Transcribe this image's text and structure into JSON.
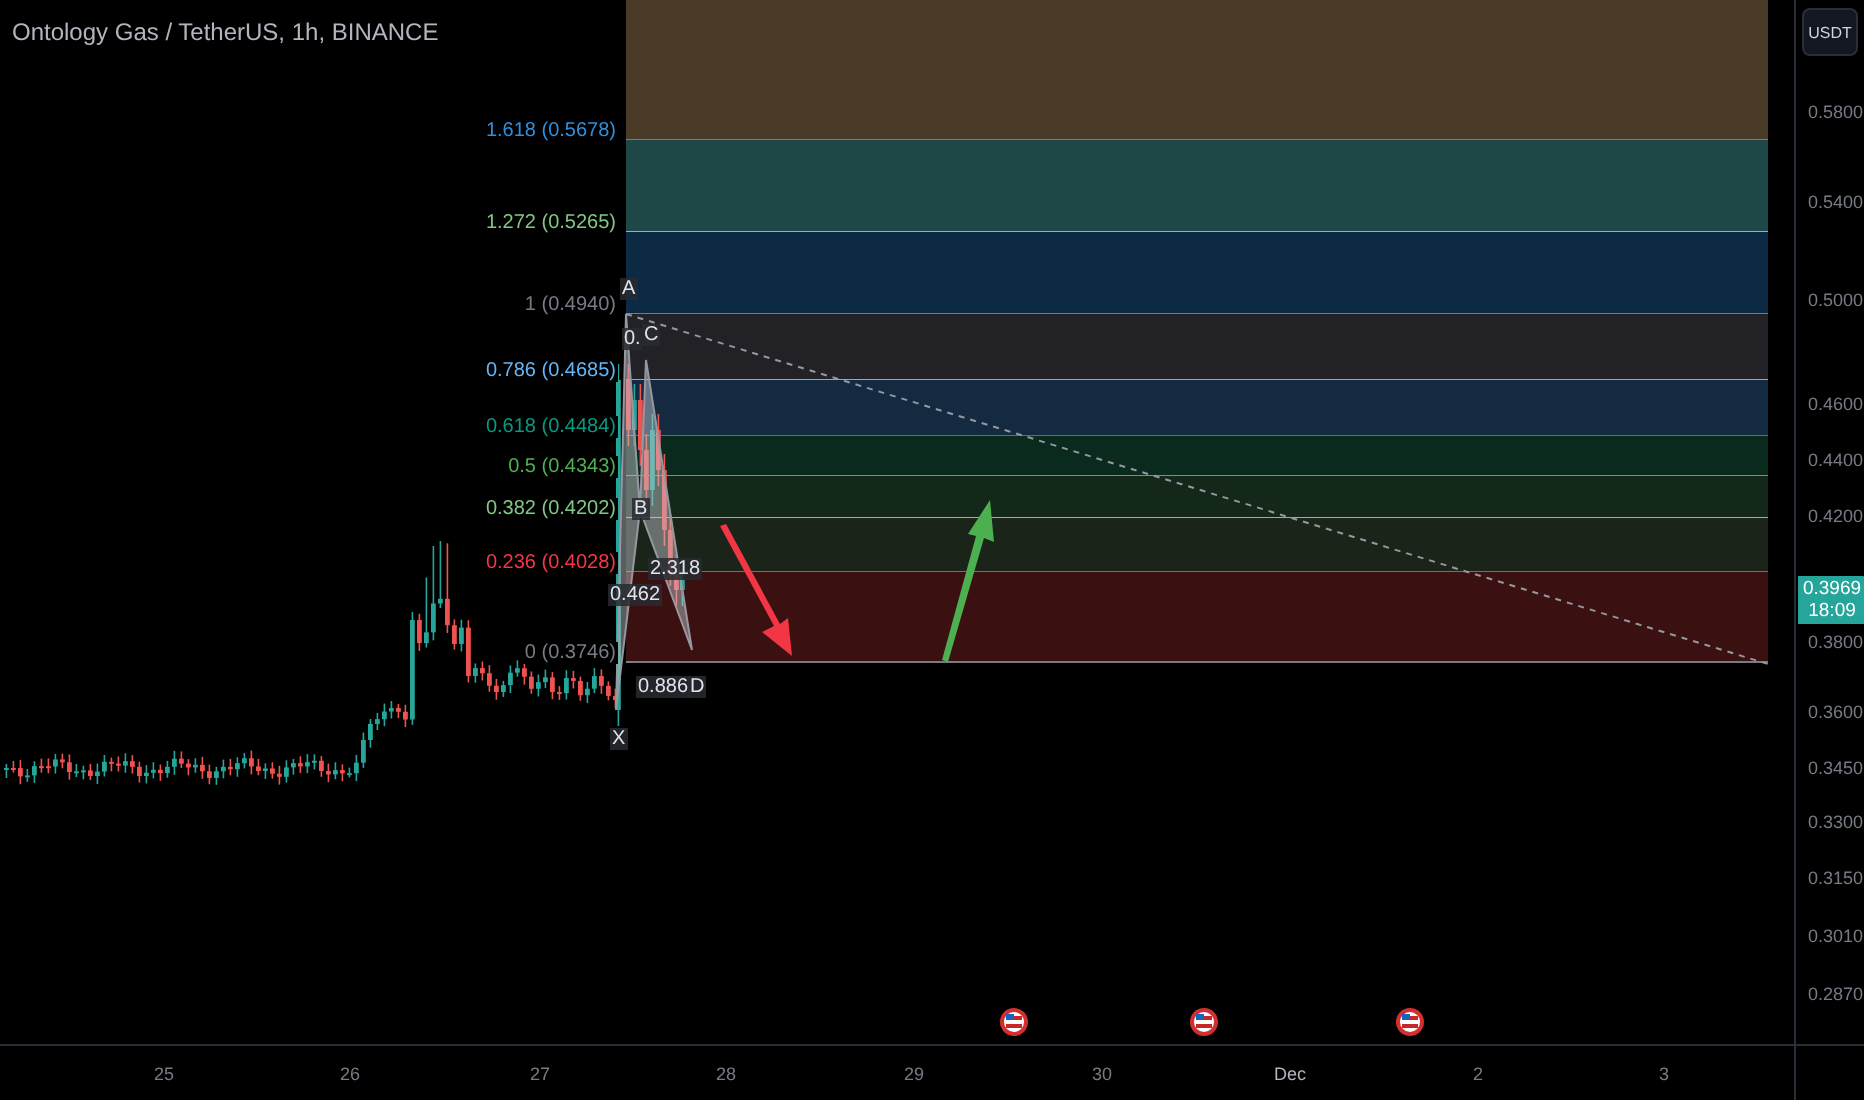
{
  "title": "Ontology Gas / TetherUS, 1h, BINANCE",
  "currency_button": "USDT",
  "fib_levels": [
    {
      "label": "1.618 (0.5678)",
      "color": "#2f8fdd"
    },
    {
      "label": "1.272 (0.5265)",
      "color": "#81c784"
    },
    {
      "label": "1 (0.4940)",
      "color": "#787b86"
    },
    {
      "label": "0.786 (0.4685)",
      "color": "#64b5f6"
    },
    {
      "label": "0.618 (0.4484)",
      "color": "#089981"
    },
    {
      "label": "0.5 (0.4343)",
      "color": "#4caf50"
    },
    {
      "label": "0.382 (0.4202)",
      "color": "#81c784"
    },
    {
      "label": "0.236 (0.4028)",
      "color": "#f23645"
    },
    {
      "label": "0 (0.3746)",
      "color": "#787b86"
    }
  ],
  "pattern_labels": [
    "A",
    "0.",
    "C",
    "B",
    "2.318",
    "0.462",
    "0.886",
    "D",
    "X"
  ],
  "price_axis": [
    "0.5800",
    "0.5400",
    "0.5000",
    "0.4600",
    "0.4400",
    "0.4200",
    "0.3800",
    "0.3600",
    "0.3450",
    "0.3300",
    "0.3150",
    "0.3010",
    "0.2870"
  ],
  "last_price": {
    "value": "0.3969",
    "countdown": "18:09"
  },
  "time_axis": [
    "25",
    "26",
    "27",
    "28",
    "29",
    "30",
    "Dec",
    "2",
    "3"
  ]
}
